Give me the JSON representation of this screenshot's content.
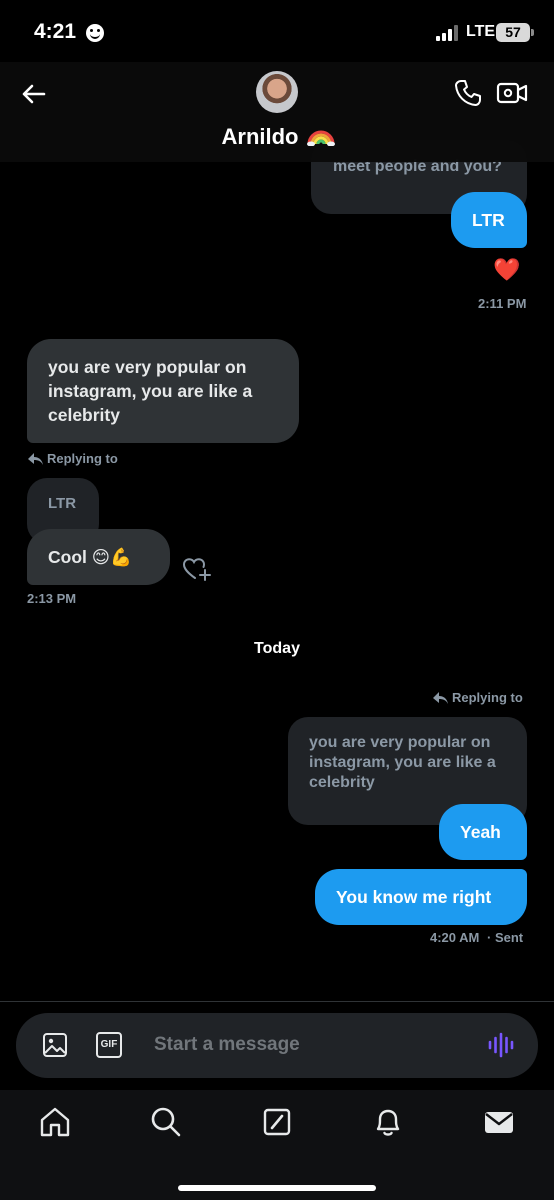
{
  "status_bar": {
    "time": "4:21",
    "network": "LTE",
    "battery": "57"
  },
  "header": {
    "contact_name": "Arnildo",
    "name_emoji_icon": "rainbow-icon",
    "back_icon": "arrow-left-icon",
    "call_icon": "phone-icon",
    "video_icon": "video-camera-icon"
  },
  "messages": {
    "quoted_top_partial": "meet people and you?",
    "ltr": "LTR",
    "reaction": "❤️",
    "time_1": "2:11 PM",
    "popular": "you are very popular on instagram, you are like a celebrity",
    "replying_to_1": "Replying to",
    "quoted_ltr": "LTR",
    "cool": "Cool 😊💪",
    "time_2": "2:13 PM",
    "day_divider": "Today",
    "replying_to_2": "Replying to",
    "quoted_popular": "you are very popular on instagram, you are like a celebrity",
    "yeah": "Yeah",
    "you_know": "You know me right",
    "time_3": "4:20 AM",
    "status_sent": "· Sent"
  },
  "composer": {
    "placeholder": "Start a message",
    "image_icon": "image-icon",
    "gif_label": "GIF",
    "voice_icon": "voice-waveform-icon"
  },
  "tabbar": {
    "items": [
      "home-icon",
      "search-icon",
      "grok-icon",
      "notifications-icon",
      "messages-icon"
    ]
  },
  "colors": {
    "accent": "#1d9bf0",
    "incoming_bubble": "#2f3336",
    "background": "#000000",
    "voice_accent": "#7856ff"
  }
}
